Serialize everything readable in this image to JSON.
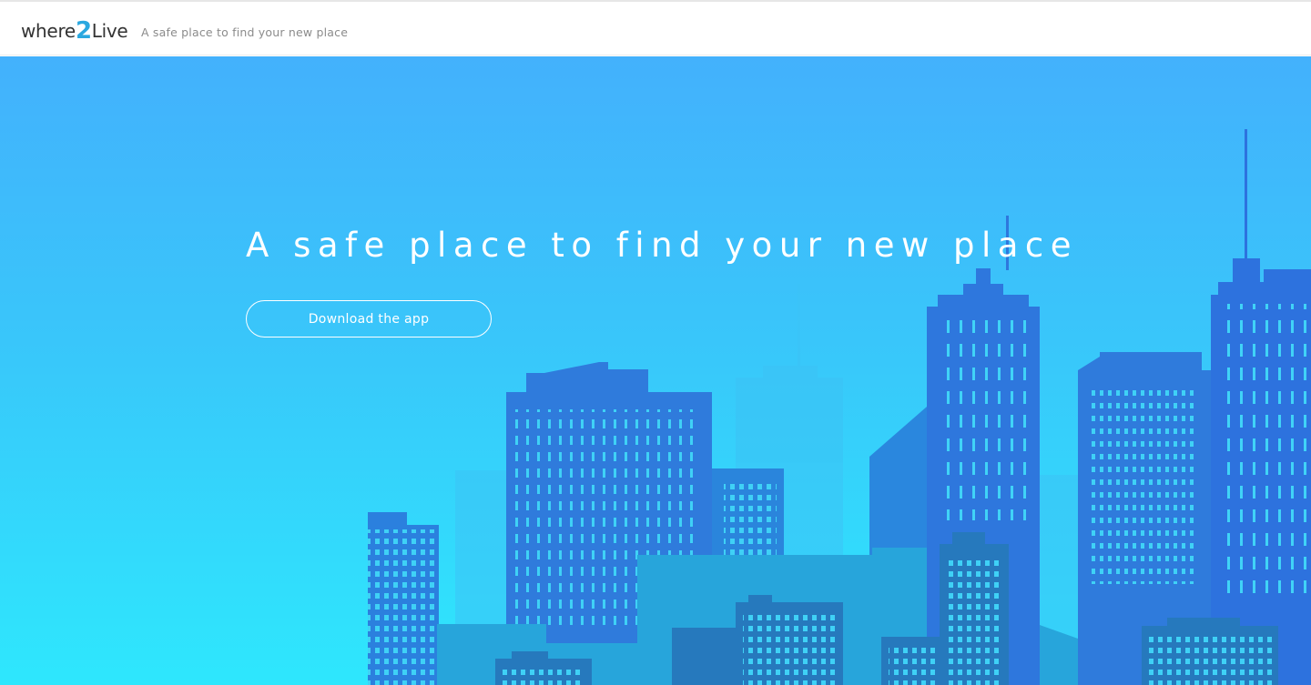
{
  "header": {
    "logo": {
      "prefix": "where",
      "digit": "2",
      "suffix": "Live"
    },
    "tagline": "A safe place to find your new place"
  },
  "hero": {
    "headline": "A safe place to find your new place",
    "cta_label": "Download the app"
  },
  "colors": {
    "sky_top": "#43b1fc",
    "sky_bottom": "#2ee7fd",
    "building_front": "#2f7bdc",
    "building_back": "#1f95cf",
    "window": "#3fd1f6",
    "logo_accent": "#2aa8e0"
  }
}
